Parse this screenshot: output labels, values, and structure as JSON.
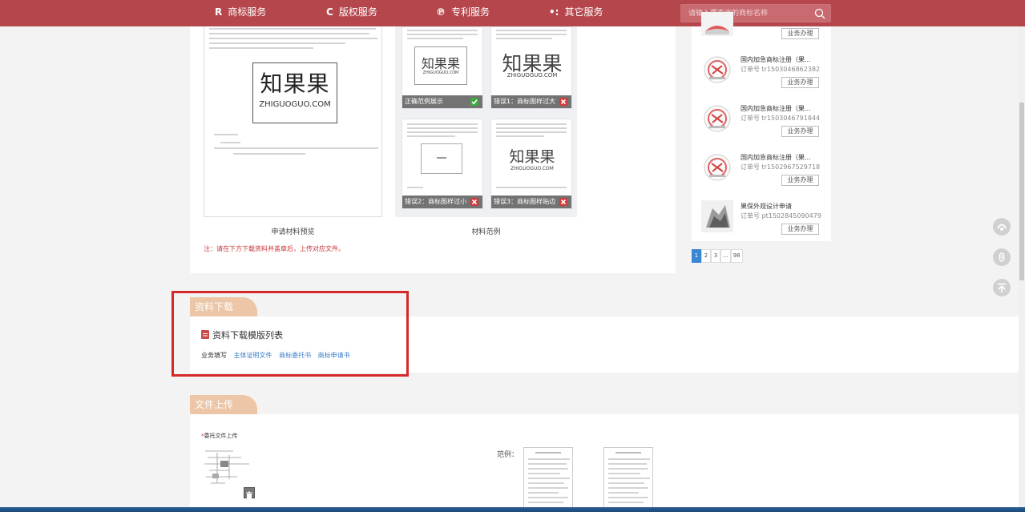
{
  "nav": {
    "items": [
      {
        "icon": "R",
        "label": "商标服务"
      },
      {
        "icon": "C",
        "label": "版权服务"
      },
      {
        "icon": "℗",
        "label": "专利服务"
      },
      {
        "icon": "•:",
        "label": "其它服务"
      }
    ],
    "search_placeholder": "请输入要查询的商标名称"
  },
  "preview": {
    "logo_cn": "知果果",
    "logo_en": "ZHIGUOGUO.COM",
    "caption": "申请材料预览",
    "note": "注：请在下方下载资料并盖章后，上传对应文件。"
  },
  "examples": {
    "caption": "材料范例",
    "logo_cn": "知果果",
    "logo_en": "ZHIGUOGUO.COM",
    "cards": [
      {
        "label": "正确范例展示",
        "status": "ok"
      },
      {
        "label": "错误1：商标图样过大",
        "status": "error"
      },
      {
        "label": "错误2：商标图样过小",
        "status": "error"
      },
      {
        "label": "错误3：商标图样贴边",
        "status": "error"
      }
    ]
  },
  "sidebar": {
    "orders": [
      {
        "title": "",
        "number": "",
        "button": "业务办理"
      },
      {
        "title": "国内加急商标注册（果...",
        "number": "订单号 tr1503046862382",
        "button": "业务办理"
      },
      {
        "title": "国内加急商标注册（果...",
        "number": "订单号 tr1503046791844",
        "button": "业务办理"
      },
      {
        "title": "国内加急商标注册（果...",
        "number": "订单号 tr1502967529718",
        "button": "业务办理"
      },
      {
        "title": "果保外观设计申请",
        "number": "订单号 pt1502845090479",
        "button": "业务办理"
      }
    ],
    "pager": [
      "1",
      "2",
      "3",
      "...",
      "98"
    ],
    "pager_active": 0
  },
  "download": {
    "tab": "资料下载",
    "title": "资料下载模版列表",
    "row_label": "业务填写",
    "links": [
      "主体证明文件",
      "商标委托书",
      "商标申请书"
    ]
  },
  "upload": {
    "tab": "文件上传",
    "field_label_required": "*",
    "field_label": "委托文件上传",
    "sample_label": "范例："
  },
  "colors": {
    "nav_bg": "#b5464c",
    "section_tab": "#ecc6a6",
    "highlight_box": "#d42a2a",
    "link": "#3a7bc8",
    "pager_active": "#3a86d3"
  }
}
